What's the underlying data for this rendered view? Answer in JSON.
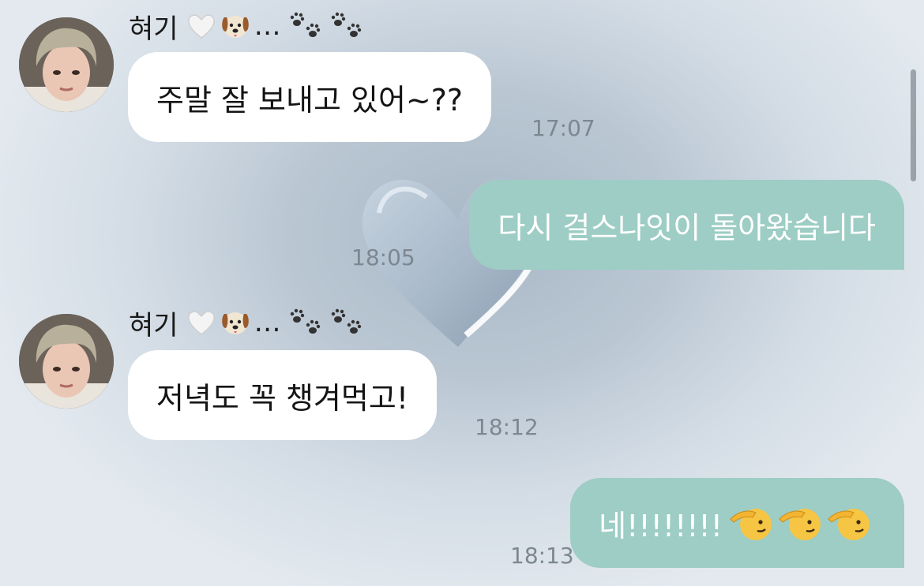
{
  "sender": {
    "name": "혀기"
  },
  "messages": [
    {
      "text": "주말 잘 보내고 있어~??",
      "time": "17:07"
    },
    {
      "text": "다시 걸스나잇이 돌아왔습니다",
      "time": "18:05"
    },
    {
      "text": "저녁도 꼭 챙겨먹고!",
      "time": "18:12"
    },
    {
      "text": "네!!!!!!!!",
      "time": "18:13"
    }
  ],
  "icons": {
    "heart": "white-heart-icon",
    "dog": "dog-face-icon",
    "paws": "paw-prints-icon",
    "salute": "saluting-face-icon"
  },
  "colors": {
    "outgoing_bubble": "#9dcdc4",
    "incoming_bubble": "#ffffff",
    "time_text": "#7d8791"
  }
}
